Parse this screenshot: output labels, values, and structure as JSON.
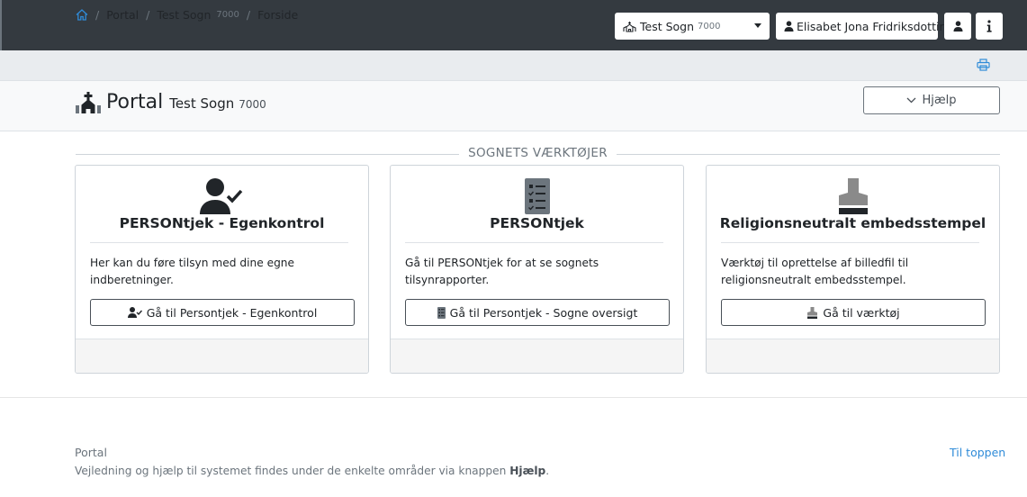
{
  "navbar": {
    "parish_select": {
      "name": "Test Sogn",
      "number": "7000"
    },
    "user_name": "Elisabet Jona Fridriksdottir"
  },
  "breadcrumb": {
    "items": [
      "Portal",
      "Test Sogn",
      "Forside"
    ],
    "parish_number": "7000"
  },
  "header": {
    "title": "Portal",
    "parish": "Test Sogn",
    "parish_number": "7000",
    "help_label": "Hjælp"
  },
  "section": {
    "title": "SOGNETS VÆRKTØJER"
  },
  "cards": [
    {
      "icon": "user-check-icon",
      "title": "PERSONtjek - Egenkontrol",
      "description": "Her kan du føre tilsyn med dine egne indberetninger.",
      "button_label": "Gå til Persontjek - Egenkontrol"
    },
    {
      "icon": "checklist-icon",
      "title": "PERSONtjek",
      "description": "Gå til PERSONtjek for at se sognets tilsynrapporter.",
      "button_label": "Gå til Persontjek - Sogne oversigt"
    },
    {
      "icon": "stamp-icon",
      "title": "Religionsneutralt embedsstempel",
      "description": "Værktøj til oprettelse af billedfil til religionsneutralt embedsstempel.",
      "button_label": "Gå til værktøj"
    }
  ],
  "footer": {
    "title": "Portal",
    "text_prefix": "Vejledning og hjælp til systemet findes under de enkelte områder via knappen",
    "text_bold": "Hjælp",
    "text_suffix": ".",
    "to_top_label": "Til toppen"
  },
  "colors": {
    "navbar": "#343a40",
    "breadcrumb_bg": "#e9ecef",
    "header_bg": "#f8f9fa",
    "link": "#2f8bd8"
  }
}
